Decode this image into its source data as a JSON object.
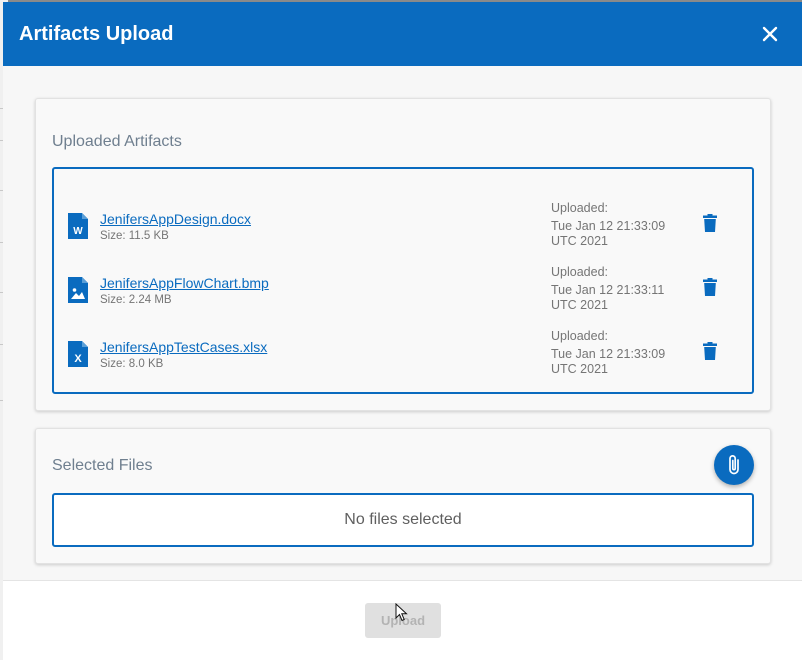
{
  "modal": {
    "title": "Artifacts Upload",
    "close_icon": "close-icon"
  },
  "uploaded": {
    "title": "Uploaded Artifacts",
    "files": [
      {
        "name": "JenifersAppDesign.docx",
        "size": "Size: 11.5 KB",
        "icon": "word-document-icon",
        "uploaded_label": "Uploaded:",
        "uploaded_date": "Tue Jan 12 21:33:09",
        "uploaded_tz": "UTC 2021"
      },
      {
        "name": "JenifersAppFlowChart.bmp",
        "size": "Size: 2.24 MB",
        "icon": "image-file-icon",
        "uploaded_label": "Uploaded:",
        "uploaded_date": "Tue Jan 12 21:33:11",
        "uploaded_tz": "UTC 2021"
      },
      {
        "name": "JenifersAppTestCases.xlsx",
        "size": "Size: 8.0 KB",
        "icon": "excel-document-icon",
        "uploaded_label": "Uploaded:",
        "uploaded_date": "Tue Jan 12 21:33:09",
        "uploaded_tz": "UTC 2021"
      }
    ]
  },
  "selected": {
    "title": "Selected Files",
    "empty_text": "No files selected",
    "attach_icon": "paperclip-icon"
  },
  "footer": {
    "upload_label": "Upload"
  },
  "colors": {
    "primary": "#0a6bbf",
    "muted_text": "#757575"
  }
}
